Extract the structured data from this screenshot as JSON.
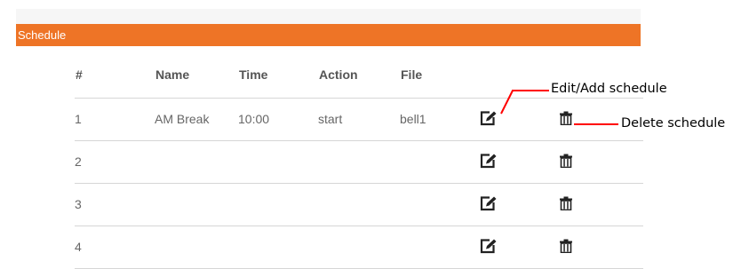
{
  "colors": {
    "accent": "#ee7426",
    "annotation": "#ff0000"
  },
  "panel": {
    "title": "Schedule"
  },
  "table": {
    "headers": {
      "num": "#",
      "name": "Name",
      "time": "Time",
      "action": "Action",
      "file": "File"
    },
    "rows": [
      {
        "num": "1",
        "name": "AM Break",
        "time": "10:00",
        "action": "start",
        "file": "bell1"
      },
      {
        "num": "2",
        "name": "",
        "time": "",
        "action": "",
        "file": ""
      },
      {
        "num": "3",
        "name": "",
        "time": "",
        "action": "",
        "file": ""
      },
      {
        "num": "4",
        "name": "",
        "time": "",
        "action": "",
        "file": ""
      }
    ],
    "row_icons": {
      "edit": "edit-icon",
      "delete": "trash-icon"
    }
  },
  "annotations": {
    "edit_add": "Edit/Add schedule",
    "delete": "Delete schedule"
  }
}
